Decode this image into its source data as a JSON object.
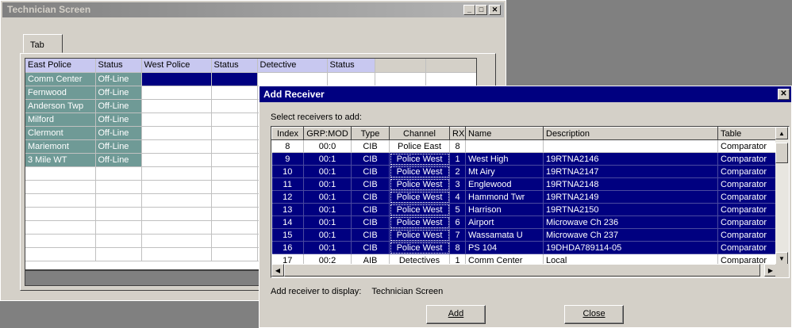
{
  "technician_window": {
    "title": "Technician Screen",
    "tab_label": "Tab",
    "columns": [
      "East Police",
      "Status",
      "West Police",
      "Status",
      "Detective",
      "Status",
      "",
      ""
    ],
    "rows": [
      [
        "Comm Center",
        "Off-Line"
      ],
      [
        "Fernwood",
        "Off-Line"
      ],
      [
        "Anderson Twp",
        "Off-Line"
      ],
      [
        "Milford",
        "Off-Line"
      ],
      [
        "Clermont",
        "Off-Line"
      ],
      [
        "Mariemont",
        "Off-Line"
      ],
      [
        "3 Mile WT",
        "Off-Line"
      ]
    ]
  },
  "dialog": {
    "title": "Add Receiver",
    "select_label": "Select receivers to add:",
    "columns": [
      "Index",
      "GRP:MOD",
      "Type",
      "Channel",
      "RX",
      "Name",
      "Description",
      "Table"
    ],
    "rows": [
      {
        "index": "8",
        "grp_mod": "00:0",
        "type": "CIB",
        "channel": "Police East",
        "rx": "8",
        "name": "",
        "description": "",
        "table": "Comparator",
        "selected": false
      },
      {
        "index": "9",
        "grp_mod": "00:1",
        "type": "CIB",
        "channel": "Police West",
        "rx": "1",
        "name": "West High",
        "description": "19RTNA2146",
        "table": "Comparator",
        "selected": true
      },
      {
        "index": "10",
        "grp_mod": "00:1",
        "type": "CIB",
        "channel": "Police West",
        "rx": "2",
        "name": "Mt Airy",
        "description": "19RTNA2147",
        "table": "Comparator",
        "selected": true
      },
      {
        "index": "11",
        "grp_mod": "00:1",
        "type": "CIB",
        "channel": "Police West",
        "rx": "3",
        "name": "Englewood",
        "description": "19RTNA2148",
        "table": "Comparator",
        "selected": true
      },
      {
        "index": "12",
        "grp_mod": "00:1",
        "type": "CIB",
        "channel": "Police West",
        "rx": "4",
        "name": "Hammond Twr",
        "description": "19RTNA2149",
        "table": "Comparator",
        "selected": true
      },
      {
        "index": "13",
        "grp_mod": "00:1",
        "type": "CIB",
        "channel": "Police West",
        "rx": "5",
        "name": "Harrison",
        "description": "19RTNA2150",
        "table": "Comparator",
        "selected": true
      },
      {
        "index": "14",
        "grp_mod": "00:1",
        "type": "CIB",
        "channel": "Police West",
        "rx": "6",
        "name": "Airport",
        "description": "Microwave Ch 236",
        "table": "Comparator",
        "selected": true
      },
      {
        "index": "15",
        "grp_mod": "00:1",
        "type": "CIB",
        "channel": "Police West",
        "rx": "7",
        "name": "Wassamata U",
        "description": "Microwave Ch 237",
        "table": "Comparator",
        "selected": true
      },
      {
        "index": "16",
        "grp_mod": "00:1",
        "type": "CIB",
        "channel": "Police West",
        "rx": "8",
        "name": "PS 104",
        "description": "19DHDA789114-05",
        "table": "Comparator",
        "selected": true
      },
      {
        "index": "17",
        "grp_mod": "00:2",
        "type": "AIB",
        "channel": "Detectives",
        "rx": "1",
        "name": "Comm Center",
        "description": "Local",
        "table": "Comparator",
        "selected": false
      }
    ],
    "display_label": "Add receiver to display:",
    "display_value": "Technician Screen",
    "add_button": "Add",
    "close_button": "Close"
  },
  "colors": {
    "selection": "#000080",
    "status_teal": "#6f9a96",
    "header_blue": "#c8c8f0",
    "face": "#d4d0c8"
  }
}
